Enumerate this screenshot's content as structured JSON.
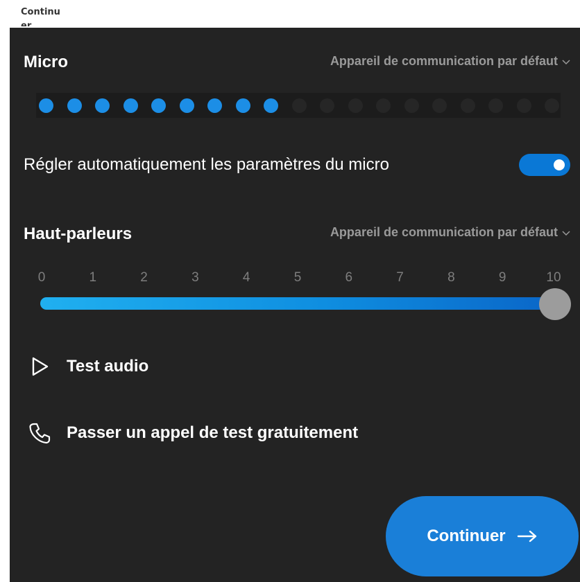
{
  "window": {
    "truncated_title": "Continuer"
  },
  "micro": {
    "title": "Micro",
    "device": "Appareil de communication par défaut",
    "level_dots_total": 19,
    "level_dots_active": 9,
    "auto_adjust_label": "Régler automatiquement les paramètres du micro",
    "auto_adjust_on": true
  },
  "speakers": {
    "title": "Haut-parleurs",
    "device": "Appareil de communication par défaut",
    "scale": [
      "0",
      "1",
      "2",
      "3",
      "4",
      "5",
      "6",
      "7",
      "8",
      "9",
      "10"
    ],
    "volume": 10
  },
  "actions": {
    "test_audio": "Test audio",
    "test_call": "Passer un appel de test gratuitement"
  },
  "footer": {
    "continue_label": "Continuer"
  },
  "colors": {
    "panel_bg": "#232323",
    "accent": "#1a7fd8",
    "dot_active": "#1c8ee6",
    "muted_text": "#9a9a9a"
  },
  "icons": {
    "chevron": "chevron-down-icon",
    "play": "play-icon",
    "phone": "phone-icon",
    "arrow": "arrow-right-icon"
  }
}
